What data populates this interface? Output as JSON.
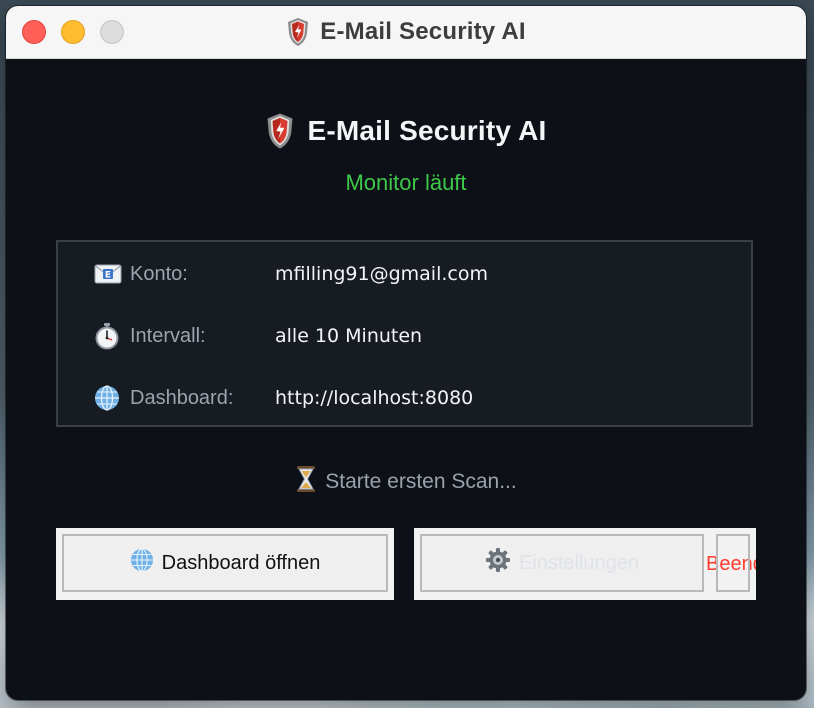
{
  "window": {
    "title": "E-Mail Security AI"
  },
  "app": {
    "title": "E-Mail Security AI",
    "status": "Monitor läuft",
    "status_color": "#3ec84a"
  },
  "info": {
    "rows": [
      {
        "icon": "envelope-icon",
        "label": "Konto:",
        "value": "mfilling91@gmail.com"
      },
      {
        "icon": "stopwatch-icon",
        "label": "Intervall:",
        "value": "alle 10 Minuten"
      },
      {
        "icon": "globe-icon",
        "label": "Dashboard:",
        "value": "http://localhost:8080"
      }
    ]
  },
  "scan": {
    "icon": "hourglass-icon",
    "text": "Starte ersten Scan..."
  },
  "buttons": {
    "dashboard": {
      "icon": "globe-icon",
      "label": "Dashboard öffnen"
    },
    "settings": {
      "icon": "gear-icon",
      "label": "Einstellungen"
    },
    "quit": {
      "label": "Beenden",
      "visible_label": "Beend"
    }
  },
  "colors": {
    "background": "#0d1117",
    "card_border": "#3a4048",
    "quit_text": "#ff3b30"
  }
}
